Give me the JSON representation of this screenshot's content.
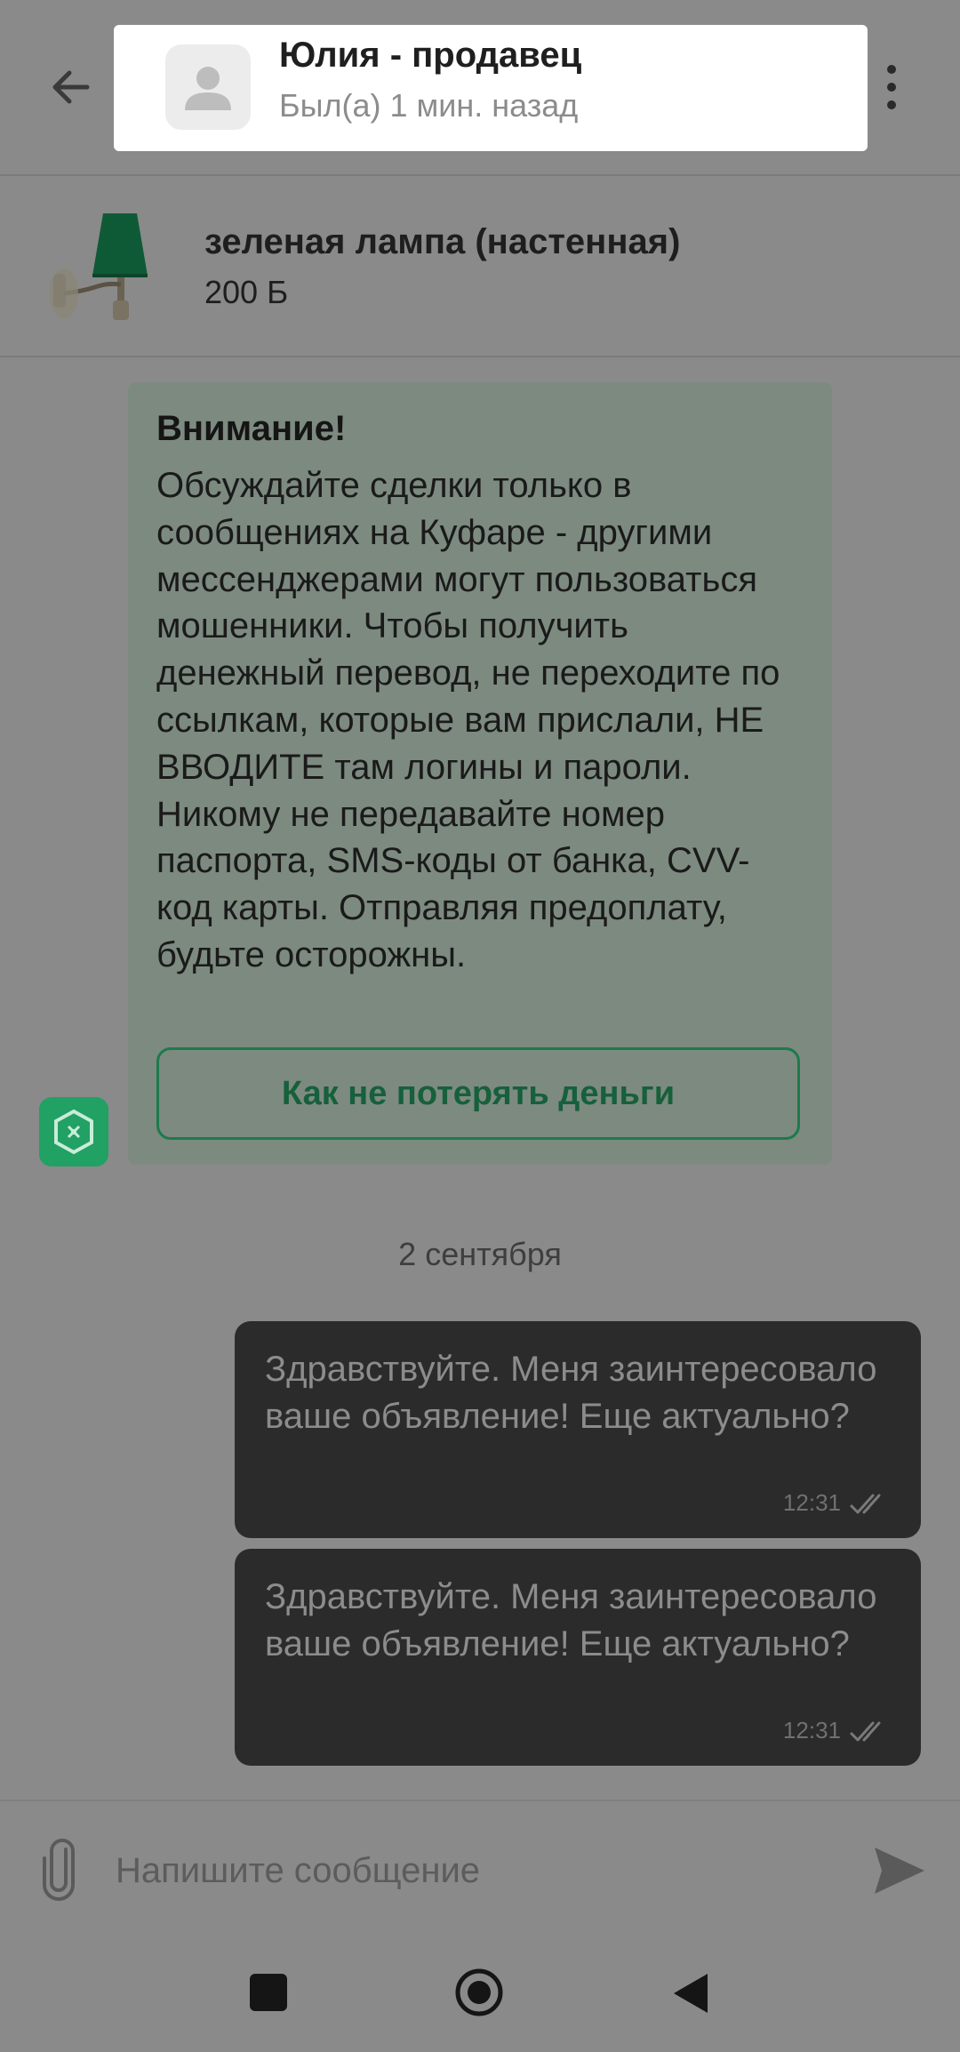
{
  "header": {
    "seller_name": "Юлия - продавец",
    "seller_status": "Был(а) 1 мин. назад",
    "icons": {
      "back": "arrow-left-icon",
      "avatar": "person-icon",
      "menu": "more-vertical-icon"
    }
  },
  "product": {
    "title": "зеленая лампа (настенная)",
    "price": "200 Ƃ",
    "thumbnail": "green wall lamp"
  },
  "notice": {
    "title": "Внимание!",
    "text": "Обсуждайте сделки только в сообщениях на Куфаре - другими мессенджерами могут пользоваться мошенники. Чтобы получить денежный перевод, не переходите по ссылкам, которые вам прислали, НЕ ВВОДИТЕ там логины и пароли. Никому не передавайте номер паспорта, SMS-коды от банка, CVV-код карты. Отправляя предоплату, будьте осторожны.",
    "link_label": "Как не потерять деньги",
    "bot_icon": "kufar-logo-icon"
  },
  "date_separator": "2 сентября",
  "messages": [
    {
      "text": "Здравствуйте. Меня заинтересовало ваше объявление! Еще актуально?",
      "time": "12:31",
      "status": "read"
    },
    {
      "text": "Здравствуйте. Меня заинтересовало ваше объявление! Еще актуально?",
      "time": "12:31",
      "status": "read"
    }
  ],
  "composer": {
    "placeholder": "Напишите сообщение",
    "value": "",
    "icons": {
      "attach": "paperclip-icon",
      "send": "send-icon"
    }
  },
  "system_nav": {
    "icons": [
      "recent-apps-icon",
      "home-icon",
      "back-triangle-icon"
    ]
  },
  "colors": {
    "overlay": "#8a8a8a",
    "highlight": "#ffffff",
    "notice_bg": "#7d8a80",
    "accent_green": "#21a163",
    "bubble_bg": "#2b2b2b"
  }
}
